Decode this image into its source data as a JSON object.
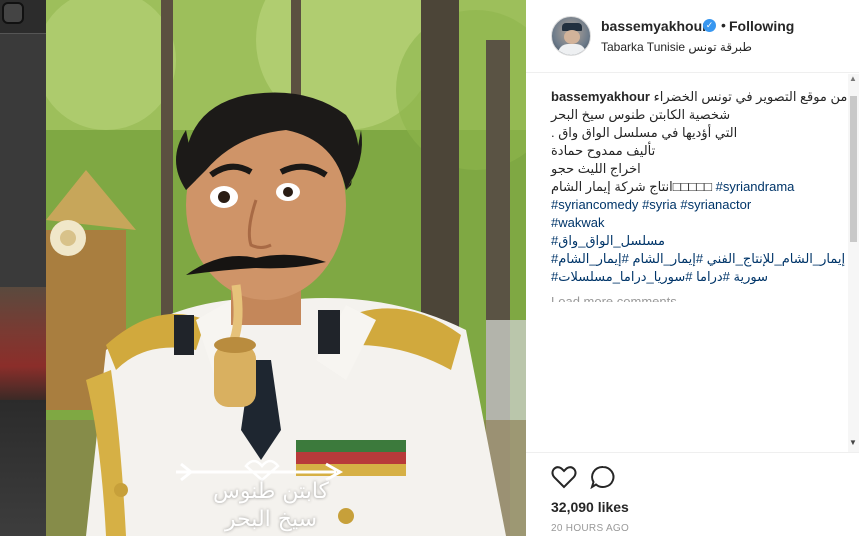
{
  "post": {
    "username": "bassemyakhour",
    "follow_status": "Following",
    "separator": "•",
    "verified_mark": "✓",
    "location": "Tabarka Tunisie طبرقة تونس"
  },
  "caption": {
    "username": "bassemyakhour",
    "lines": [
      "من موقع التصوير في تونس الخضراء",
      "شخصية الكابتن طنوس سيخ البحر",
      "التي أؤديها في مسلسل الواق واق .",
      "تأليف ممدوح حمادة",
      "اخراج الليث حجو"
    ],
    "line6_prefix": "انتاج شركة إيمار الشام",
    "line6_boxes": "□□□□□",
    "hashtags": {
      "h1": "#syriandrama",
      "h2": "#syriancomedy",
      "h3": "#syria",
      "h4": "#syrianactor",
      "h5": "#wakwak",
      "h6": "#مسلسل_الواق_واق",
      "h7": "#إيمار_الشام_للإنتاج_الفني",
      "h8": "#إيمار_الشام",
      "h9": "#إيمار_الشام",
      "h10": "#سورية",
      "h11": "#دراما",
      "h12": "#سوريا_دراما_مسلسلات"
    }
  },
  "load_more": "Load more comments",
  "likes": "32,090 likes",
  "timestamp": "20 HOURS AGO",
  "photo_overlay": {
    "line1": "كابتن طنوس",
    "line2": "سيخ البحر"
  },
  "icons": {
    "like": "heart-icon",
    "comment": "comment-icon",
    "verified": "verified-badge-icon"
  },
  "colors": {
    "verified": "#3897f0",
    "hashtag": "#003569",
    "text": "#262626",
    "muted": "#999999"
  }
}
